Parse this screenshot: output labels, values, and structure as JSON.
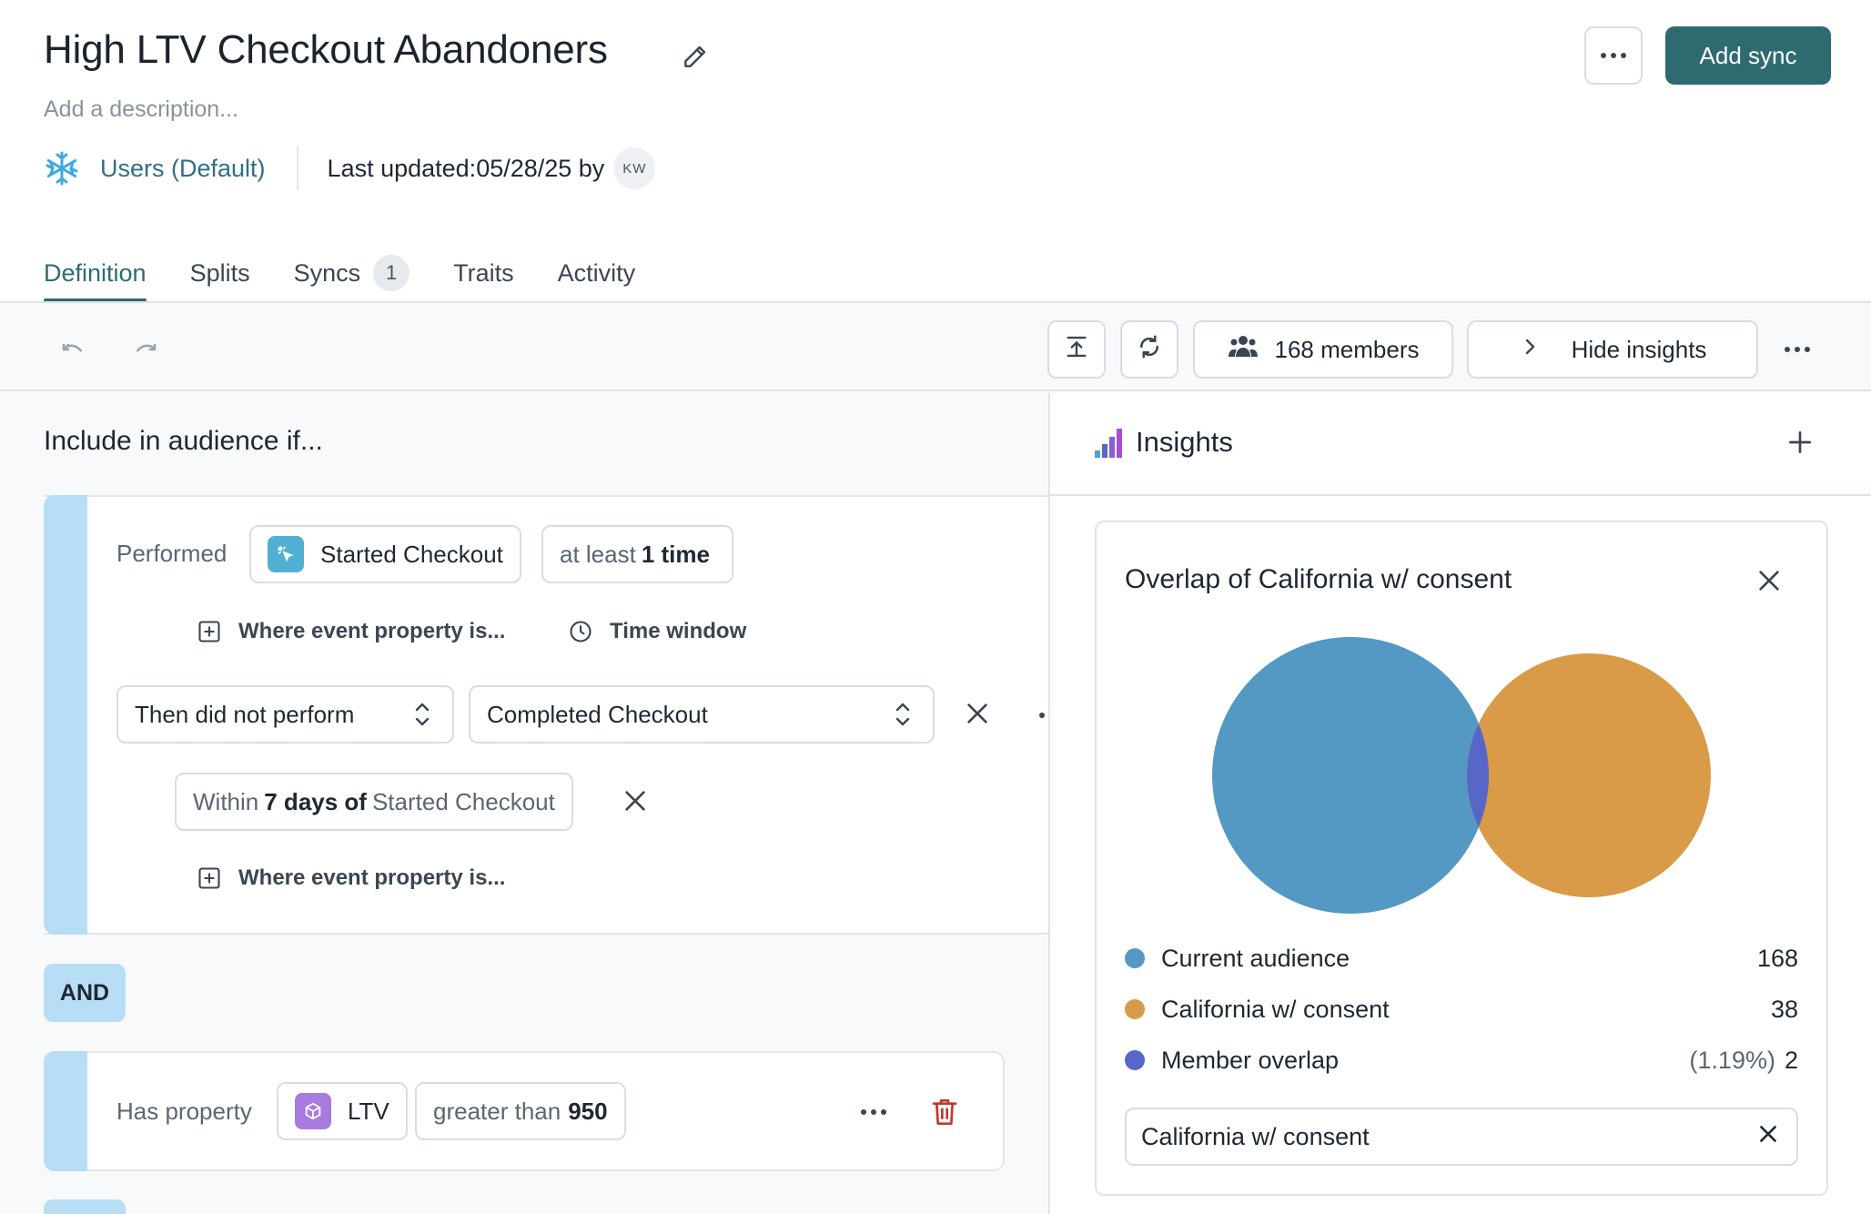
{
  "header": {
    "title": "High LTV Checkout Abandoners",
    "description_placeholder": "Add a description...",
    "source_name": "Users (Default)",
    "last_updated_label": "Last updated:",
    "last_updated_value": "05/28/25 by",
    "updated_by_initials": "KW",
    "add_sync_label": "Add sync",
    "icons": {
      "edit": "pencil-icon",
      "source": "snowflake-icon",
      "more": "more-horizontal-icon"
    }
  },
  "tabs": [
    {
      "label": "Definition",
      "active": true
    },
    {
      "label": "Splits"
    },
    {
      "label": "Syncs",
      "badge": "1"
    },
    {
      "label": "Traits"
    },
    {
      "label": "Activity"
    }
  ],
  "toolbar": {
    "members_label": "168 members",
    "insights_toggle_label": "Hide insights",
    "icons": [
      "undo-icon",
      "redo-icon",
      "export-icon",
      "refresh-icon",
      "users-icon",
      "chevron-right-icon",
      "more-horizontal-icon"
    ]
  },
  "definition": {
    "include_label": "Include in audience if...",
    "condition1": {
      "performed_label": "Performed",
      "event": "Started Checkout",
      "frequency_prefix": "at least",
      "frequency_value": "1 time",
      "where_label": "Where event property is...",
      "time_window_label": "Time window",
      "then_select": "Then did not perform",
      "then_event": "Completed Checkout",
      "within_prefix": "Within",
      "within_value": "7 days of",
      "within_event": "Started Checkout",
      "where_label_2": "Where event property is..."
    },
    "and_label": "AND",
    "condition2": {
      "has_property_label": "Has property",
      "property": "LTV",
      "operator": "greater than",
      "value": "950"
    }
  },
  "insights": {
    "title": "Insights",
    "card_title": "Overlap of California w/ consent",
    "legend": [
      {
        "name": "Current audience",
        "value": "168",
        "color": "#5499c4"
      },
      {
        "name": "California w/ consent",
        "value": "38",
        "color": "#d99b48"
      },
      {
        "name": "Member overlap",
        "percent": "(1.19%)",
        "value": "2",
        "color": "#5866c7"
      }
    ],
    "filter_chip": "California w/ consent"
  },
  "colors": {
    "accent": "#2e6b70",
    "condition_bar": "#b7def5",
    "delete": "#c0392b"
  }
}
